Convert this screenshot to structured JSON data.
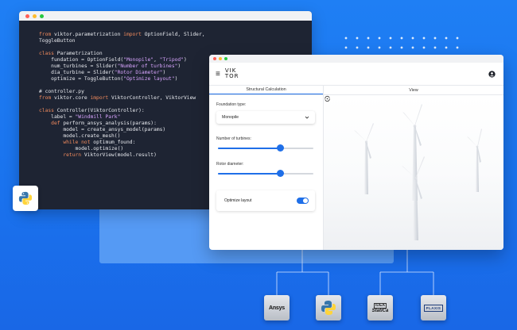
{
  "code": {
    "lines": [
      "from viktor.parametrization import OptionField, Slider,",
      "ToggleButton",
      "",
      "class Parametrization",
      "    fundation = OptionField(\"Monopile\", \"Tripod\")",
      "    num_turbines = Slider(\"Number of turbines\")",
      "    dia_turbine = Slider(\"Rotor Diameter\")",
      "    optimize = ToggleButton(\"Optimize layout\")",
      "",
      "# controller.py",
      "from viktor.core import ViktorController, ViktorView",
      "",
      "class Controller(ViktorController):",
      "    label = \"Windmill Park\"",
      "    def perform_ansys_analysis(params):",
      "        model = create_ansys_model(params)",
      "        model.create_mesh()",
      "        while not optimum_found:",
      "            model.optimize()",
      "        return ViktorView(model.result)"
    ]
  },
  "app": {
    "logo_top": "VIK",
    "logo_bottom": "TOR",
    "tabs": {
      "left": "Structural Calculation",
      "right": "View"
    },
    "fields": {
      "foundation_label": "Foundation type:",
      "foundation_value": "Monopile",
      "turbines_label": "Number of turbines:",
      "turbines_level": 0.65,
      "rotor_label": "Rotor diameter:",
      "rotor_level": 0.65,
      "optimize_label": "Optimize layout",
      "optimize_on": true
    }
  },
  "software": {
    "ansys": "Ansys",
    "idea_top": "IDEA",
    "idea_bottom": "StatiCa",
    "plaxis": "PLAXIS"
  },
  "colors": {
    "accent": "#1f6fe8",
    "background": "#1a73ee",
    "code_bg": "#1e2433"
  }
}
